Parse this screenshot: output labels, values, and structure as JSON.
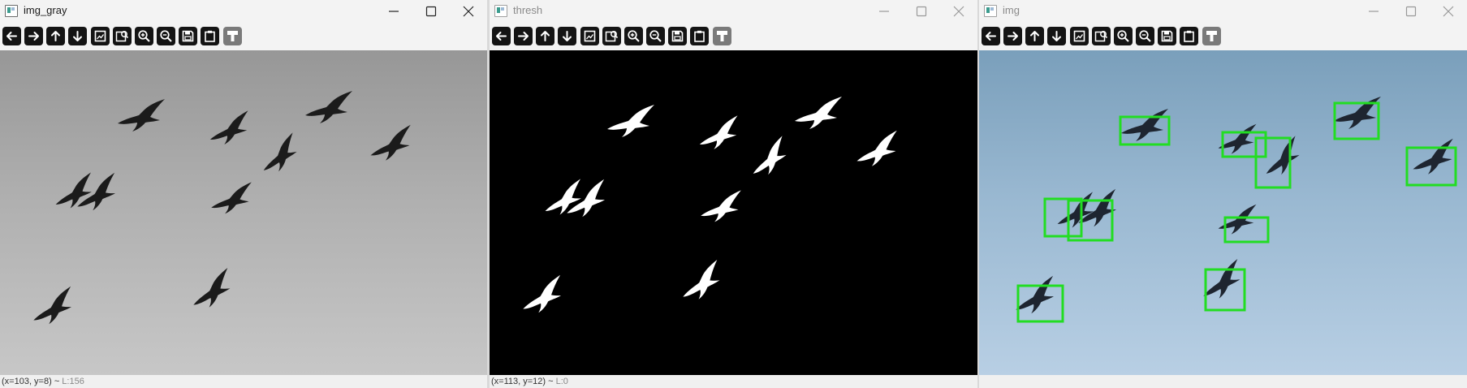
{
  "windows": [
    {
      "title": "img_gray",
      "status": {
        "coords": "(x=103, y=8) ~ ",
        "level": "L:156"
      }
    },
    {
      "title": "thresh",
      "status": {
        "coords": "(x=113, y=12) ~ ",
        "level": "L:0"
      }
    },
    {
      "title": "img",
      "status": {
        "coords": "",
        "level": ""
      }
    }
  ],
  "toolbar_icons": [
    "arrow-left-icon",
    "arrow-right-icon",
    "arrow-up-icon",
    "arrow-down-icon",
    "zoom-fit-icon",
    "zoom-region-icon",
    "zoom-in-icon",
    "zoom-out-icon",
    "save-icon",
    "clipboard-icon",
    "properties-icon"
  ],
  "window_controls": [
    "minimize-icon",
    "maximize-icon",
    "close-icon"
  ],
  "colors": {
    "box": "#22dd22",
    "bird_gray": "#1b1b1b",
    "bird_thresh": "#ffffff",
    "bird_color": "#1e2530",
    "toolbar_button": "#141414"
  }
}
